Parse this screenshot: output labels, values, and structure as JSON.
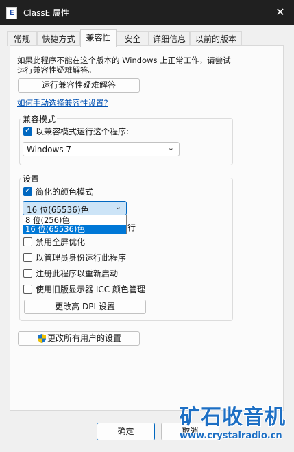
{
  "window": {
    "title": "ClassE 属性",
    "icon": "app-icon"
  },
  "tabs": [
    {
      "label": "常规",
      "active": false
    },
    {
      "label": "快捷方式",
      "active": false
    },
    {
      "label": "兼容性",
      "active": true
    },
    {
      "label": "安全",
      "active": false
    },
    {
      "label": "详细信息",
      "active": false
    },
    {
      "label": "以前的版本",
      "active": false
    }
  ],
  "compat": {
    "intro_line1": "如果此程序不能在这个版本的 Windows 上正常工作，请尝试",
    "intro_line2": "运行兼容性疑难解答。",
    "troubleshoot_button": "运行兼容性疑难解答",
    "manual_link": "如何手动选择兼容性设置?",
    "mode_group_label": "兼容模式",
    "mode_checkbox_label": "以兼容模式运行这个程序:",
    "mode_checkbox_checked": true,
    "mode_select_value": "Windows 7",
    "settings_group_label": "设置",
    "reduced_color_label": "简化的颜色模式",
    "reduced_color_checked": true,
    "color_select_value": "16 位(65536)色",
    "color_options": [
      "8 位(256)色",
      "16 位(65536)色"
    ],
    "color_option_selected_index": 1,
    "resolution_partial": "行",
    "fullscreen_label": "禁用全屏优化",
    "admin_label": "以管理员身份运行此程序",
    "register_restart_label": "注册此程序以重新启动",
    "legacy_icc_label": "使用旧版显示器 ICC 颜色管理",
    "dpi_button": "更改高 DPI 设置",
    "all_users_button": "更改所有用户的设置"
  },
  "footer": {
    "ok_button": "确定",
    "cancel_partial": "取消"
  },
  "watermark": {
    "text": "矿石收音机",
    "url": "www.crystalradio.cn"
  },
  "colors": {
    "accent": "#0067c0",
    "titlebar": "#202020",
    "link": "#0050b3",
    "watermark": "#1d6fc4"
  }
}
